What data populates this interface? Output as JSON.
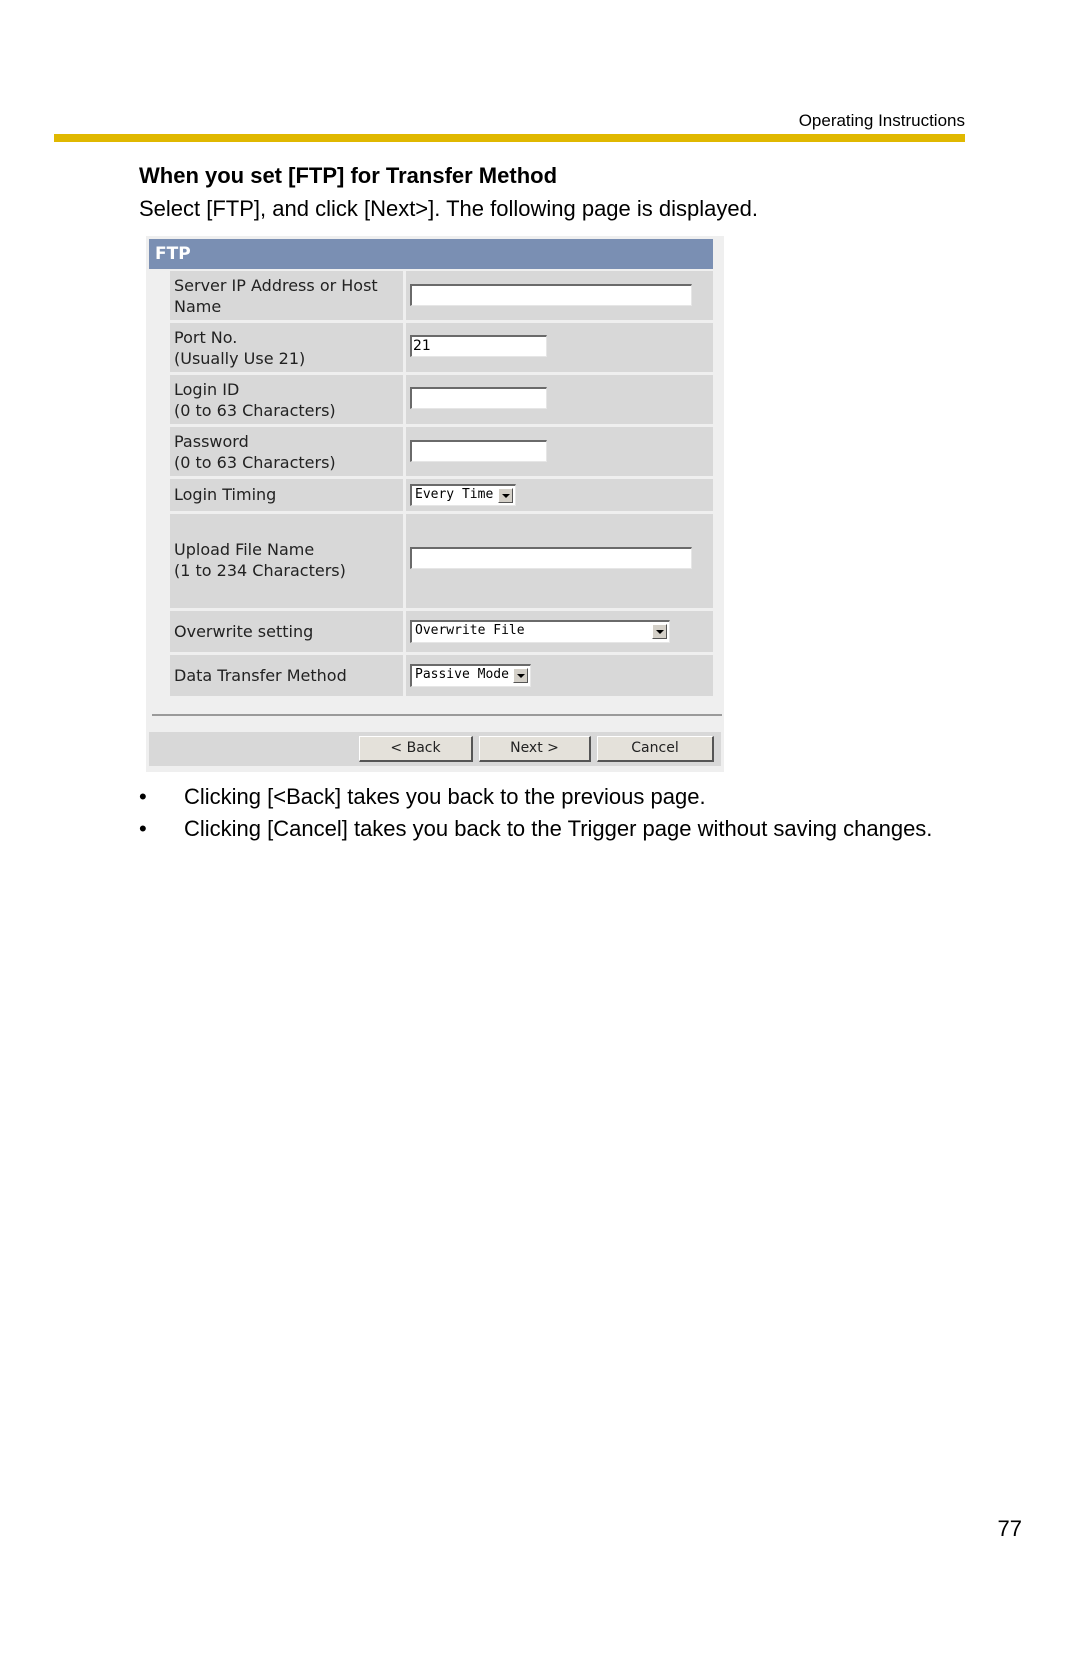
{
  "header": {
    "running_title": "Operating Instructions",
    "accent_color": "#e0b800"
  },
  "section": {
    "title": "When you set [FTP] for Transfer Method",
    "intro": "Select [FTP], and click [Next>]. The following page is displayed."
  },
  "ftp_form": {
    "panel_title": "FTP",
    "panel_title_color": "#7a8fb3",
    "fields": [
      {
        "label_line1": "Server IP Address or Host",
        "label_line2": "Name",
        "type": "text",
        "value": ""
      },
      {
        "label_line1": "Port No.",
        "label_line2": "(Usually Use 21)",
        "type": "text",
        "value": "21"
      },
      {
        "label_line1": "Login ID",
        "label_line2": "(0 to 63 Characters)",
        "type": "text",
        "value": ""
      },
      {
        "label_line1": "Password",
        "label_line2": "(0 to 63 Characters)",
        "type": "password",
        "value": ""
      },
      {
        "label_line1": "Login Timing",
        "label_line2": "",
        "type": "select",
        "value": "Every Time"
      },
      {
        "label_line1": "Upload File Name",
        "label_line2": "(1 to 234 Characters)",
        "type": "text",
        "value": ""
      },
      {
        "label_line1": "Overwrite setting",
        "label_line2": "",
        "type": "select",
        "value": "Overwrite File"
      },
      {
        "label_line1": "Data Transfer Method",
        "label_line2": "",
        "type": "select",
        "value": "Passive Mode"
      }
    ],
    "buttons": {
      "back": "< Back",
      "next": "Next >",
      "cancel": "Cancel"
    }
  },
  "notes": [
    "Clicking [<Back] takes you back to the previous page.",
    "Clicking [Cancel] takes you back to the Trigger page without saving changes."
  ],
  "bullet_symbol": "•",
  "page_number": "77"
}
